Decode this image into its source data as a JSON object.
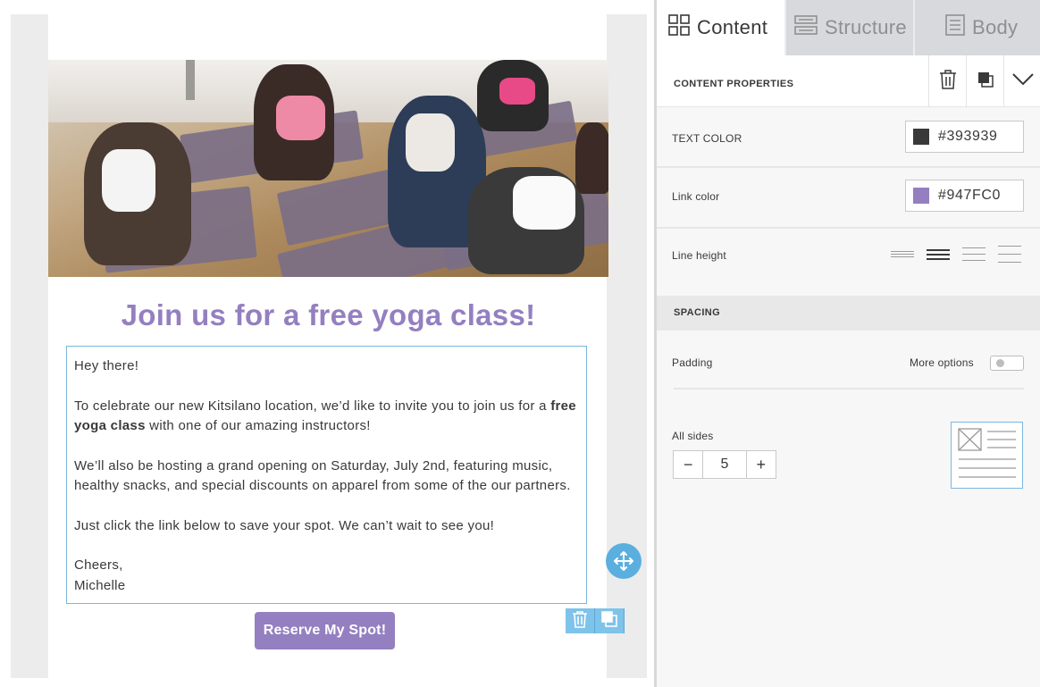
{
  "email": {
    "hero_image": "Group yoga class meditating on mats",
    "headline": "Join us for a free yoga class!",
    "body": {
      "greeting": "Hey there!",
      "p1_before": "To celebrate our new Kitsilano location, we’d like to invite you to join us for a ",
      "p1_bold": "free yoga class",
      "p1_after": " with one of our amazing instructors!",
      "p2": "We’ll also be hosting a grand opening on Saturday, July 2nd, featuring music, healthy snacks, and special discounts on apparel from some of the our partners.",
      "p3": "Just click the link below to save your spot. We can’t wait to see you!",
      "closing": "Cheers,",
      "signature": "Michelle"
    },
    "cta_label": "Reserve My Spot!"
  },
  "tabs": [
    {
      "label": "Content",
      "icon": "grid-icon",
      "active": true
    },
    {
      "label": "Structure",
      "icon": "rows-icon",
      "active": false
    },
    {
      "label": "Body",
      "icon": "document-icon",
      "active": false
    }
  ],
  "panel": {
    "title": "CONTENT PROPERTIES",
    "text_color": {
      "label": "TEXT COLOR",
      "value": "#393939"
    },
    "link_color": {
      "label": "Link color",
      "value": "#947FC0"
    },
    "line_height": {
      "label": "Line height",
      "selected_index": 1
    },
    "spacing": {
      "section_title": "SPACING",
      "padding_label": "Padding",
      "more_options_label": "More options",
      "more_options_enabled": false,
      "all_sides_label": "All sides",
      "all_sides_value": "5",
      "minus": "−",
      "plus": "+"
    }
  },
  "colors": {
    "accent": "#947fc0",
    "text": "#393939",
    "selection": "#7ab8dd",
    "handle": "#5aafdf"
  }
}
